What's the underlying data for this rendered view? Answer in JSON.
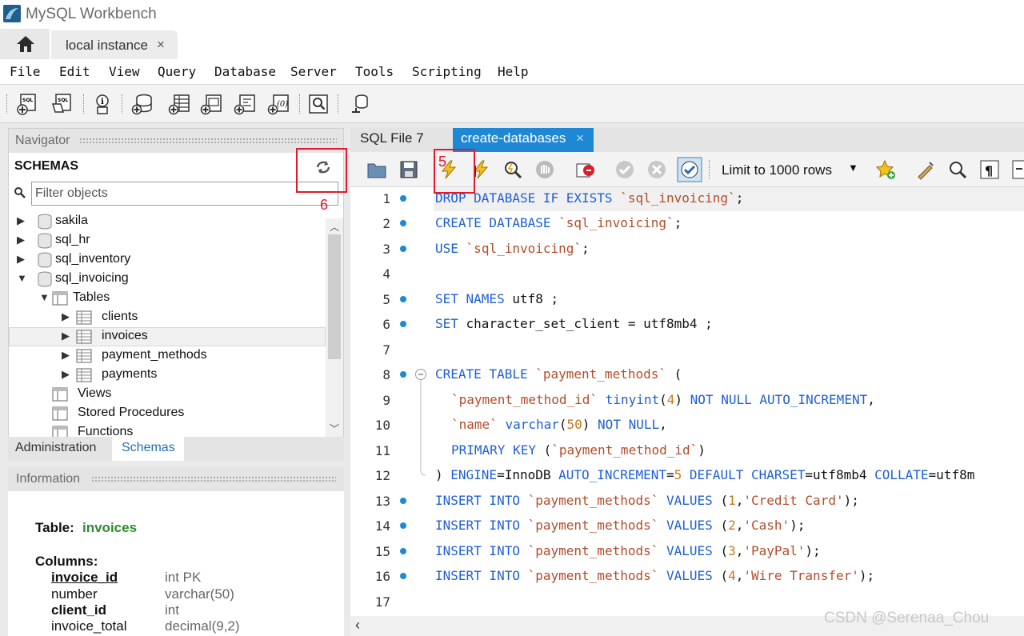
{
  "window": {
    "title": "MySQL Workbench"
  },
  "instance_tab": {
    "label": "local instance",
    "close": "×"
  },
  "menu": [
    "File",
    "Edit",
    "View",
    "Query",
    "Database",
    "Server",
    "Tools",
    "Scripting",
    "Help"
  ],
  "toolbar_icons": [
    "new-sql-tab-icon",
    "open-sql-script-icon",
    "inspector-icon",
    "create-schema-icon",
    "create-table-icon",
    "create-view-icon",
    "create-procedure-icon",
    "create-function-icon",
    "search-table-data-icon",
    "reconnect-icon"
  ],
  "navigator": {
    "title": "Navigator",
    "schemas_title": "SCHEMAS",
    "filter_placeholder": "Filter objects",
    "tree": {
      "schemas": [
        "sakila",
        "sql_hr",
        "sql_inventory",
        "sql_invoicing"
      ],
      "tables_folder": "Tables",
      "tables": [
        "clients",
        "invoices",
        "payment_methods",
        "payments"
      ],
      "views": "Views",
      "procedures": "Stored Procedures",
      "functions": "Functions"
    },
    "tabs": {
      "administration": "Administration",
      "schemas": "Schemas"
    }
  },
  "information": {
    "title": "Information",
    "table_label": "Table:",
    "table_name": "invoices",
    "columns_label": "Columns:",
    "columns": [
      {
        "name": "invoice_id",
        "type": "int PK"
      },
      {
        "name": "number",
        "type": "varchar(50)"
      },
      {
        "name": "client_id",
        "type": "int"
      },
      {
        "name": "invoice_total",
        "type": "decimal(9,2)"
      }
    ]
  },
  "editor": {
    "tabs": [
      {
        "label": "SQL File 7"
      },
      {
        "label": "create-databases",
        "close": "×"
      }
    ],
    "limit_rows": "Limit to 1000 rows",
    "lines": [
      "1",
      "2",
      "3",
      "4",
      "5",
      "6",
      "7",
      "8",
      "9",
      "10",
      "11",
      "12",
      "13",
      "14",
      "15",
      "16",
      "17"
    ],
    "code": {
      "l1": [
        "DROP DATABASE IF EXISTS",
        " ",
        "`sql_invoicing`",
        ";"
      ],
      "l2": [
        "CREATE DATABASE",
        " ",
        "`sql_invoicing`",
        ";"
      ],
      "l3": [
        "USE",
        " ",
        "`sql_invoicing`",
        ";"
      ],
      "l5": [
        "SET NAMES",
        " utf8 ;"
      ],
      "l6": [
        "SET",
        " character_set_client = utf8mb4 ;"
      ],
      "l8": [
        "CREATE TABLE",
        " ",
        "`payment_methods`",
        " ("
      ],
      "l9": [
        "`payment_method_id`",
        " ",
        "tinyint",
        "(",
        "4",
        ") ",
        "NOT NULL AUTO_INCREMENT",
        ","
      ],
      "l10": [
        "`name`",
        " ",
        "varchar",
        "(",
        "50",
        ") ",
        "NOT NULL",
        ","
      ],
      "l11": [
        "PRIMARY KEY",
        " (",
        "`payment_method_id`",
        ")"
      ],
      "l12": [
        ") ",
        "ENGINE",
        "=InnoDB ",
        "AUTO_INCREMENT",
        "=",
        "5",
        " ",
        "DEFAULT CHARSET",
        "=utf8mb4 ",
        "COLLATE",
        "=utf8m"
      ],
      "l13": [
        "INSERT INTO",
        " ",
        "`payment_methods`",
        " ",
        "VALUES",
        " (",
        "1",
        ",",
        "'Credit Card'",
        ");"
      ],
      "l14": [
        "INSERT INTO",
        " ",
        "`payment_methods`",
        " ",
        "VALUES",
        " (",
        "2",
        ",",
        "'Cash'",
        ");"
      ],
      "l15": [
        "INSERT INTO",
        " ",
        "`payment_methods`",
        " ",
        "VALUES",
        " (",
        "3",
        ",",
        "'PayPal'",
        ");"
      ],
      "l16": [
        "INSERT INTO",
        " ",
        "`payment_methods`",
        " ",
        "VALUES",
        " (",
        "4",
        ",",
        "'Wire Transfer'",
        ");"
      ]
    }
  },
  "annotations": {
    "a5": "5",
    "a6": "6"
  },
  "watermark": "CSDN @Serenaa_Chou",
  "colors": {
    "accent": "#1e88d4",
    "keyword": "#1e5fd6",
    "string": "#b34c2b",
    "number": "#c47a1a",
    "annotation": "#e3192b",
    "table_name": "#2e8b2e"
  }
}
